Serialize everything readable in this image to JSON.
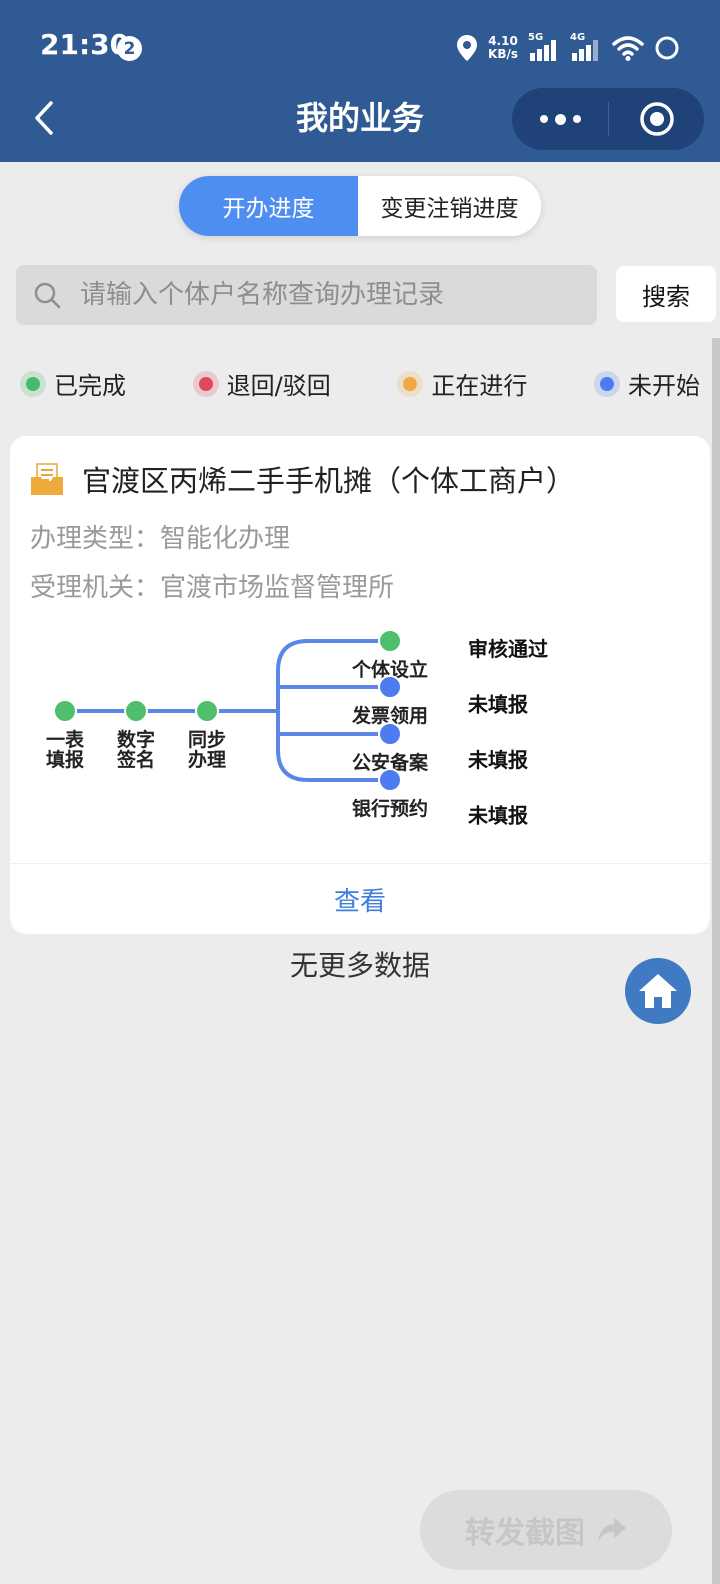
{
  "status_bar": {
    "time": "21:30",
    "notification_count": "2",
    "net_speed_value": "4.10",
    "net_speed_unit": "KB/s",
    "sim1_label": "5G",
    "sim2_label": "4G"
  },
  "nav": {
    "title": "我的业务"
  },
  "segment": {
    "tabs": [
      "开办进度",
      "变更注销进度"
    ],
    "selected": "开办进度"
  },
  "search": {
    "placeholder": "请输入个体户名称查询办理记录",
    "value": "",
    "button_label": "搜索"
  },
  "legend": {
    "items": [
      {
        "label": "已完成",
        "color": "#47b96a"
      },
      {
        "label": "退回/驳回",
        "color": "#e2475c"
      },
      {
        "label": "正在进行",
        "color": "#f3a843"
      },
      {
        "label": "未开始",
        "color": "#4d7cf0"
      }
    ]
  },
  "record": {
    "title": "官渡区丙烯二手手机摊（个体工商户）",
    "type_label": "办理类型：",
    "type_value": "智能化办理",
    "agency_label": "受理机关：",
    "agency_value": "官渡市场监督管理所",
    "flow": {
      "main_steps": [
        {
          "line1": "一表",
          "line2": "填报",
          "status": "completed"
        },
        {
          "line1": "数字",
          "line2": "签名",
          "status": "completed"
        },
        {
          "line1": "同步",
          "line2": "办理",
          "status": "completed"
        }
      ],
      "branches": [
        {
          "label": "个体设立",
          "status_text": "审核通过",
          "status": "completed"
        },
        {
          "label": "发票领用",
          "status_text": "未填报",
          "status": "not_started"
        },
        {
          "label": "公安备案",
          "status_text": "未填报",
          "status": "not_started"
        },
        {
          "label": "银行预约",
          "status_text": "未填报",
          "status": "not_started"
        }
      ],
      "colors": {
        "line": "#5b86e6",
        "completed": "#4fbf6e",
        "not_started": "#4d7cf0"
      }
    },
    "view_label": "查看"
  },
  "list_footer": "无更多数据",
  "share_button": "转发截图",
  "icons": {
    "back": "chevron-left-icon",
    "more": "more-dots-icon",
    "target": "target-icon",
    "search": "search-icon",
    "record": "folder-document-icon",
    "home": "home-icon",
    "share": "share-arrow-icon"
  },
  "colors": {
    "header_bg": "#2f5a94",
    "accent_blue": "#4f8ef1",
    "link_blue": "#3f7fdc",
    "page_bg": "#ececec"
  }
}
